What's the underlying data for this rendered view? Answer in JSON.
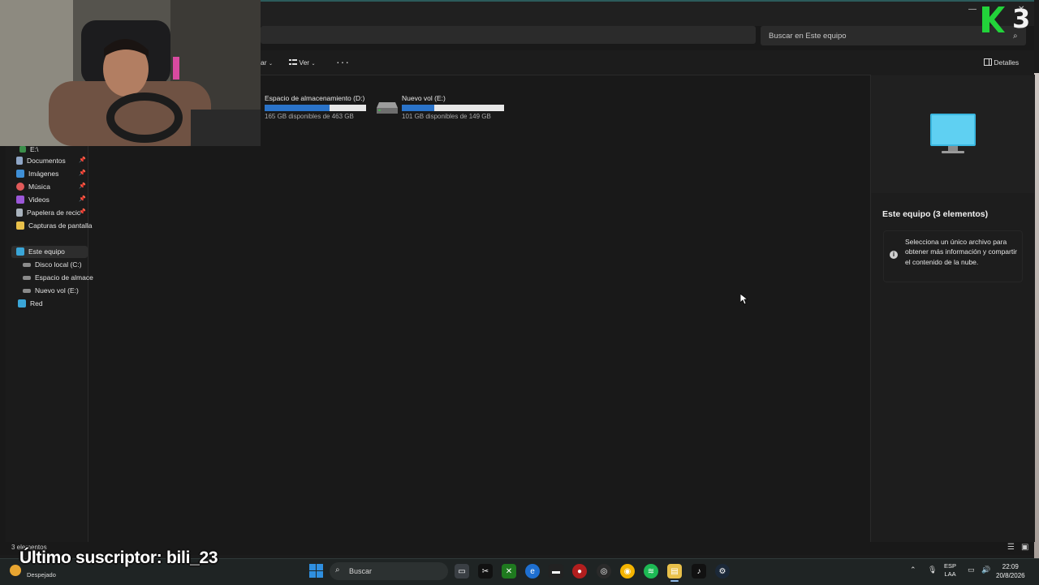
{
  "window": {
    "search_placeholder": "Buscar en Este equipo",
    "controls": {
      "minimize": "—",
      "close": "✕"
    }
  },
  "commandbar": {
    "cut_label": "ar",
    "view_label": "Ver",
    "more_label": "···",
    "details_label": "Detalles"
  },
  "drives": [
    {
      "name": "Espacio de almacenamiento (D:)",
      "free": "165 GB disponibles de 463 GB",
      "used_fraction": 0.64
    },
    {
      "name": "Nuevo vol (E:)",
      "free": "101 GB disponibles de 149 GB",
      "used_fraction": 0.32
    }
  ],
  "nav": {
    "items": [
      {
        "label": "E:\\"
      },
      {
        "label": "Documentos"
      },
      {
        "label": "Imágenes"
      },
      {
        "label": "Música"
      },
      {
        "label": "Videos"
      },
      {
        "label": "Papelera de recic"
      },
      {
        "label": "Capturas de pantalla"
      },
      {
        "label": "Este equipo"
      },
      {
        "label": "Disco local (C:)"
      },
      {
        "label": "Espacio de almace"
      },
      {
        "label": "Nuevo vol (E:)"
      },
      {
        "label": "Red"
      }
    ]
  },
  "details": {
    "title": "Este equipo (3 elementos)",
    "info": "Selecciona un único archivo para obtener más información y compartir el contenido de la nube."
  },
  "status": {
    "count": "3 elementos"
  },
  "overlay": {
    "subscriber": "Último suscriptor: bili_23",
    "logo_number": "3"
  },
  "taskbar": {
    "search_label": "Buscar",
    "weather": "Despejado",
    "lang_top": "ESP",
    "lang_bottom": "LAA",
    "time": "22:09",
    "date": "20/8/2026"
  },
  "colors": {
    "accent": "#2a73c9",
    "logo_green": "#22d33a"
  }
}
